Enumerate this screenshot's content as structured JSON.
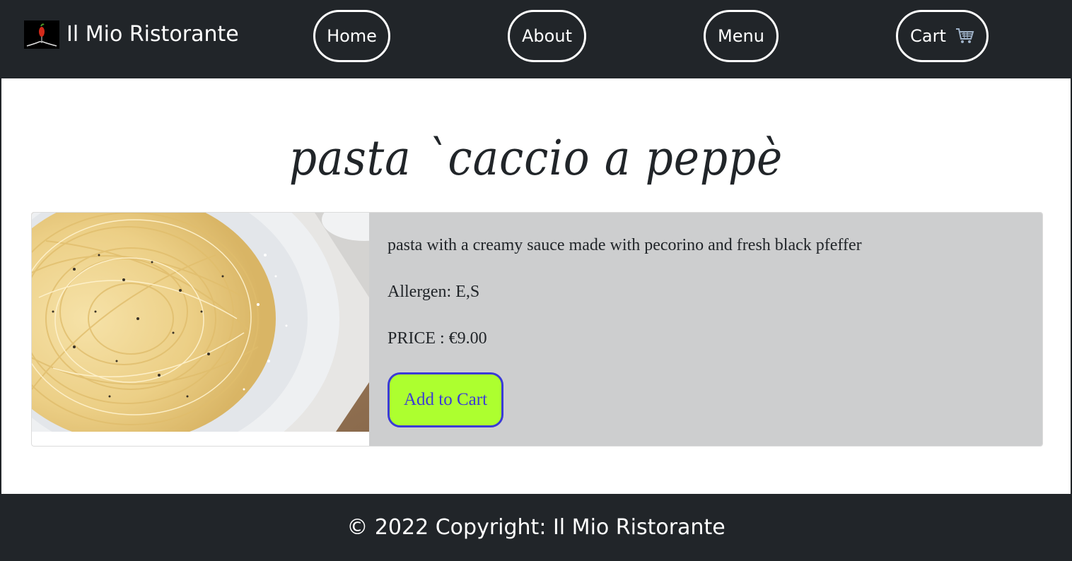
{
  "navbar": {
    "brand_name": "Il Mio Ristorante",
    "items": [
      {
        "label": "Home"
      },
      {
        "label": "About"
      },
      {
        "label": "Menu"
      },
      {
        "label": "Cart",
        "icon": "cart-icon"
      }
    ]
  },
  "dish": {
    "title": "pasta `caccio a peppè",
    "description": "pasta with a creamy sauce made with pecorino and fresh black pfeffer",
    "allergen": "Allergen: E,S",
    "price": "PRICE : €9.00",
    "add_button_label": "Add to Cart",
    "image": "cacio-e-pepe-photo"
  },
  "footer": {
    "text": "© 2022 Copyright: Il Mio Ristorante"
  },
  "colors": {
    "dark": "#212529",
    "card_info_bg": "#cdcecf",
    "button_bg": "#adff2f",
    "button_border": "#3b3bd6"
  }
}
